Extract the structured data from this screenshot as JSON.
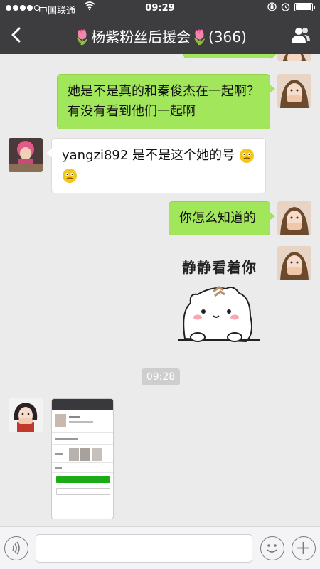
{
  "status_bar": {
    "carrier": "中国联通",
    "time": "09:29",
    "wifi_icon": "wifi-icon",
    "battery_level": 1.0
  },
  "nav": {
    "back_icon": "chevron-left-icon",
    "title": "🌷杨紫粉丝后援会🌷(366)",
    "group_icon": "people-icon"
  },
  "messages": [
    {
      "side": "right",
      "text": "她是不是真的和秦俊杰在一起啊？有没有看到他们一起啊"
    },
    {
      "side": "left",
      "text": "yangzi892 是不是这个她的号"
    },
    {
      "side": "right",
      "text": "你怎么知道的"
    },
    {
      "side": "right",
      "sticker_text": "静静看着你"
    },
    {
      "timestamp": "09:28"
    },
    {
      "side": "left",
      "type": "screenshot"
    }
  ],
  "input_bar": {
    "voice_icon": "voice-icon",
    "emoji_icon": "smiley-icon",
    "plus_icon": "plus-icon"
  },
  "colors": {
    "nav_bg": "#3d3d40",
    "chat_bg": "#ebebeb",
    "my_bubble": "#a2e65b",
    "other_bubble": "#ffffff"
  }
}
